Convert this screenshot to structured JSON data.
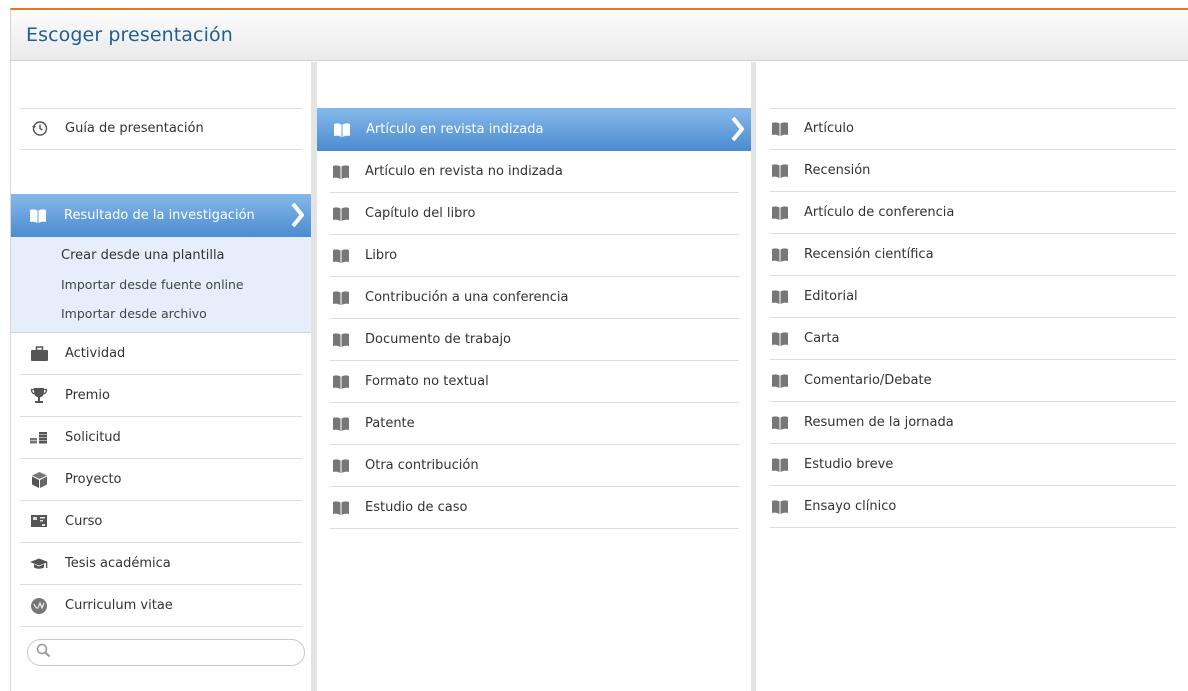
{
  "window": {
    "title": "Escoger presentación"
  },
  "col1": {
    "guide": {
      "label": "Guía de presentación",
      "icon": "history-icon"
    },
    "active": {
      "label": "Resultado de la investigación",
      "icon": "book-icon"
    },
    "submenu": [
      {
        "label": "Crear desde una plantilla"
      },
      {
        "label": "Importar desde fuente online"
      },
      {
        "label": "Importar desde archivo"
      }
    ],
    "items": [
      {
        "label": "Actividad",
        "icon": "briefcase-icon"
      },
      {
        "label": "Premio",
        "icon": "trophy-icon"
      },
      {
        "label": "Solicitud",
        "icon": "coins-icon"
      },
      {
        "label": "Proyecto",
        "icon": "cube-icon"
      },
      {
        "label": "Curso",
        "icon": "presentation-board-icon"
      },
      {
        "label": "Tesis académica",
        "icon": "graduation-cap-icon"
      },
      {
        "label": "Curriculum vitae",
        "icon": "cv-icon"
      }
    ],
    "search": {
      "placeholder": "",
      "value": ""
    }
  },
  "col2": {
    "items": [
      {
        "label": "Artículo en revista indizada"
      },
      {
        "label": "Artículo en revista no indizada"
      },
      {
        "label": "Capítulo del libro"
      },
      {
        "label": "Libro"
      },
      {
        "label": "Contribución a una conferencia"
      },
      {
        "label": "Documento de trabajo"
      },
      {
        "label": "Formato no textual"
      },
      {
        "label": "Patente"
      },
      {
        "label": "Otra contribución"
      },
      {
        "label": "Estudio de caso"
      }
    ]
  },
  "col3": {
    "items": [
      {
        "label": "Artículo"
      },
      {
        "label": "Recensión"
      },
      {
        "label": "Artículo de conferencia"
      },
      {
        "label": "Recensión científica"
      },
      {
        "label": "Editorial"
      },
      {
        "label": "Carta"
      },
      {
        "label": "Comentario/Debate"
      },
      {
        "label": "Resumen de la jornada"
      },
      {
        "label": "Estudio breve"
      },
      {
        "label": "Ensayo clínico"
      }
    ]
  },
  "colors": {
    "accent": "#4b8bd0",
    "title": "#1f5f96",
    "border_top": "#e87722",
    "submenu_bg": "#e5eefa"
  }
}
